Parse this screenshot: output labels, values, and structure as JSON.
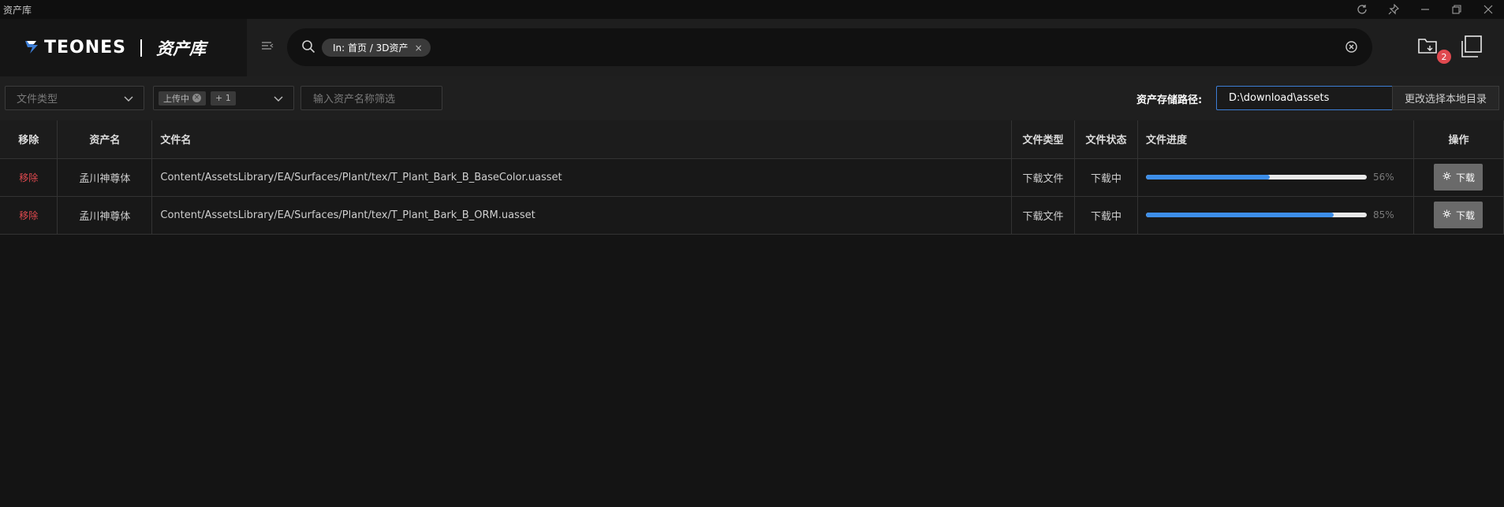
{
  "window": {
    "title": "资产库",
    "controls": [
      "refresh-icon",
      "pin-icon",
      "minimize-icon",
      "restore-icon",
      "close-icon"
    ]
  },
  "header": {
    "logo_text": "TEONES",
    "logo_cn": "资产库",
    "search": {
      "chip_label": "In: 首页 / 3D资产",
      "chip_close": "×"
    },
    "download_badge": "2"
  },
  "filters": {
    "file_type_placeholder": "文件类型",
    "status_tag": "上传中",
    "status_more": "+ 1",
    "name_placeholder": "输入资产名称筛选",
    "storage_label": "资产存储路径:",
    "storage_path": "D:\\download\\assets",
    "change_dir_button": "更改选择本地目录"
  },
  "table": {
    "headers": {
      "remove": "移除",
      "asset_name": "资产名",
      "file_name": "文件名",
      "file_type": "文件类型",
      "file_status": "文件状态",
      "file_progress": "文件进度",
      "action": "操作"
    },
    "rows": [
      {
        "remove": "移除",
        "asset_name": "孟川神尊体",
        "file_name": "Content/AssetsLibrary/EA/Surfaces/Plant/tex/T_Plant_Bark_B_BaseColor.uasset",
        "file_type": "下载文件",
        "file_status": "下载中",
        "progress": 56,
        "progress_label": "56%",
        "action": "下载"
      },
      {
        "remove": "移除",
        "asset_name": "孟川神尊体",
        "file_name": "Content/AssetsLibrary/EA/Surfaces/Plant/tex/T_Plant_Bark_B_ORM.uasset",
        "file_type": "下载文件",
        "file_status": "下载中",
        "progress": 85,
        "progress_label": "85%",
        "action": "下载"
      }
    ]
  },
  "colors": {
    "accent": "#3d8ee8",
    "danger": "#e0494f",
    "background": "#141414"
  }
}
